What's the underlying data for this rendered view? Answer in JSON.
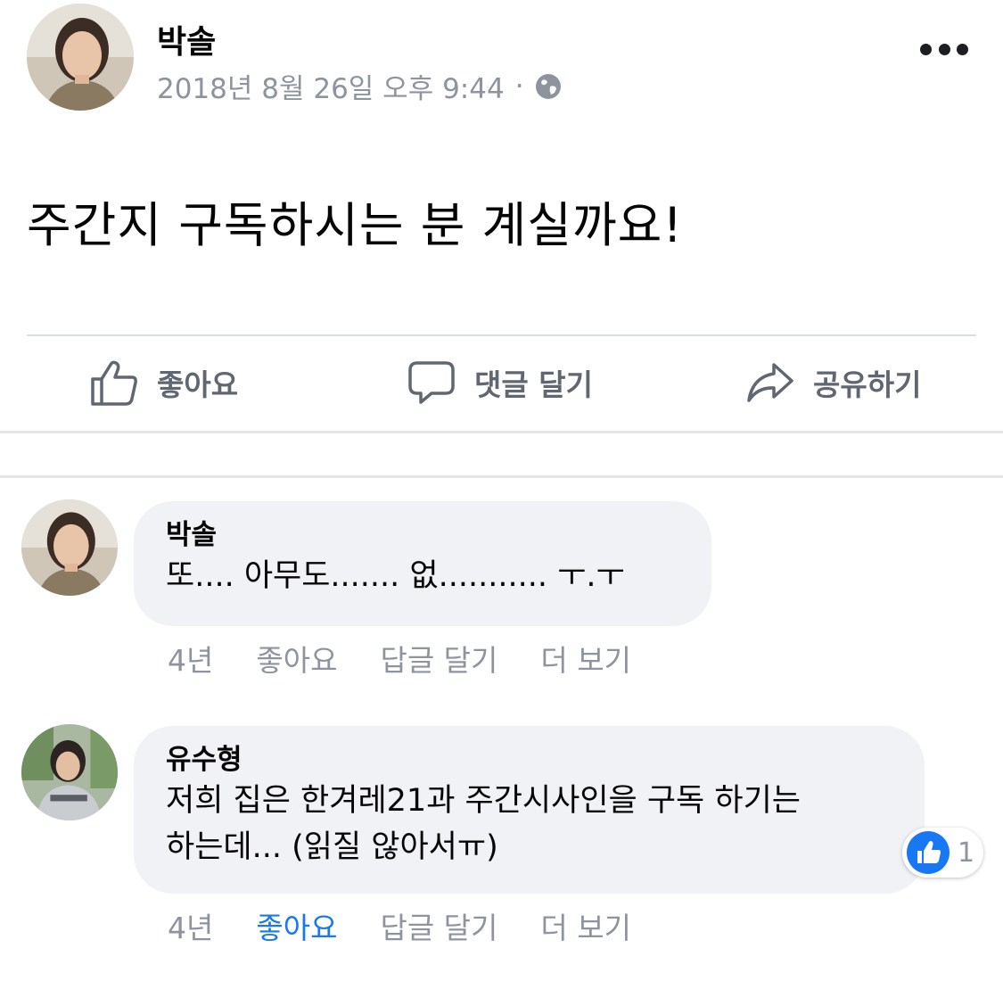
{
  "post": {
    "author": "박솔",
    "timestamp": "2018년 8월 26일 오후 9:44",
    "separator": "·",
    "privacy_icon": "globe-icon",
    "more_icon": "more-options-icon",
    "text": "주간지 구독하시는 분 계실까요!"
  },
  "actions": {
    "like_label": "좋아요",
    "comment_label": "댓글 달기",
    "share_label": "공유하기"
  },
  "comments": [
    {
      "author": "박솔",
      "text": "또.... 아무도....... 없........... ㅜ.ㅜ",
      "age": "4년",
      "like_label": "좋아요",
      "reply_label": "답글 달기",
      "more_label": "더 보기",
      "liked": false
    },
    {
      "author": "유수형",
      "text": "저희 집은 한겨레21과 주간시사인을 구독 하기는\n하는데... (읽질 않아서ㅠ)",
      "age": "4년",
      "like_label": "좋아요",
      "reply_label": "답글 달기",
      "more_label": "더 보기",
      "liked": true,
      "reaction_count": "1"
    }
  ],
  "colors": {
    "accent": "#1877f2",
    "muted_text": "#8d949e",
    "action_text": "#606770",
    "bubble_bg": "#f0f2f5"
  }
}
